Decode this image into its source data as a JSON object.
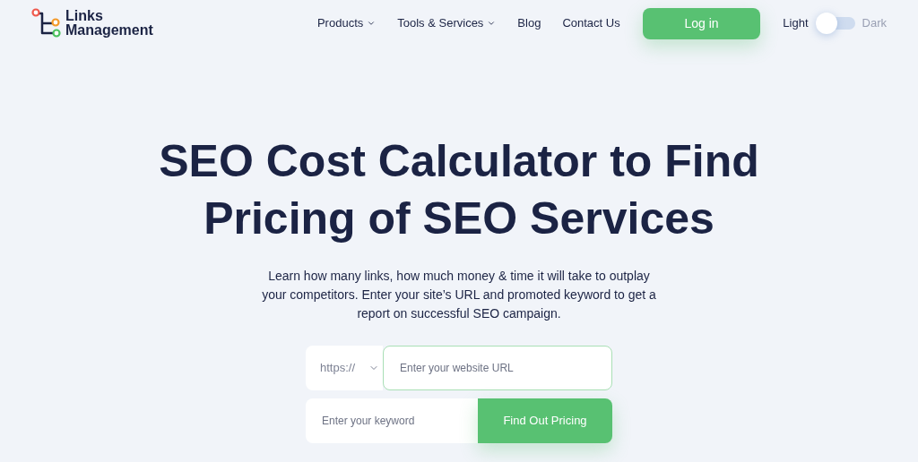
{
  "logo": {
    "line_1": "Links",
    "line_2": "Management"
  },
  "nav": [
    {
      "label": "Products",
      "has_dropdown": true
    },
    {
      "label": "Tools & Services",
      "has_dropdown": true
    },
    {
      "label": "Blog",
      "has_dropdown": false
    },
    {
      "label": "Contact Us",
      "has_dropdown": false
    }
  ],
  "login_button": "Log in",
  "theme_toggle": {
    "light_label": "Light",
    "dark_label": "Dark",
    "dark": false
  },
  "hero": {
    "title": "SEO Cost Calculator to Find Pricing of SEO Services",
    "description": "Learn how many links, how much money & time it will take to outplay your competitors. Enter your site’s URL and promoted keyword to get a report on successful SEO campaign."
  },
  "form": {
    "protocol": "https://",
    "url_placeholder": "Enter your website URL",
    "keyword_placeholder": "Enter your keyword",
    "submit": "Find Out Pricing"
  }
}
